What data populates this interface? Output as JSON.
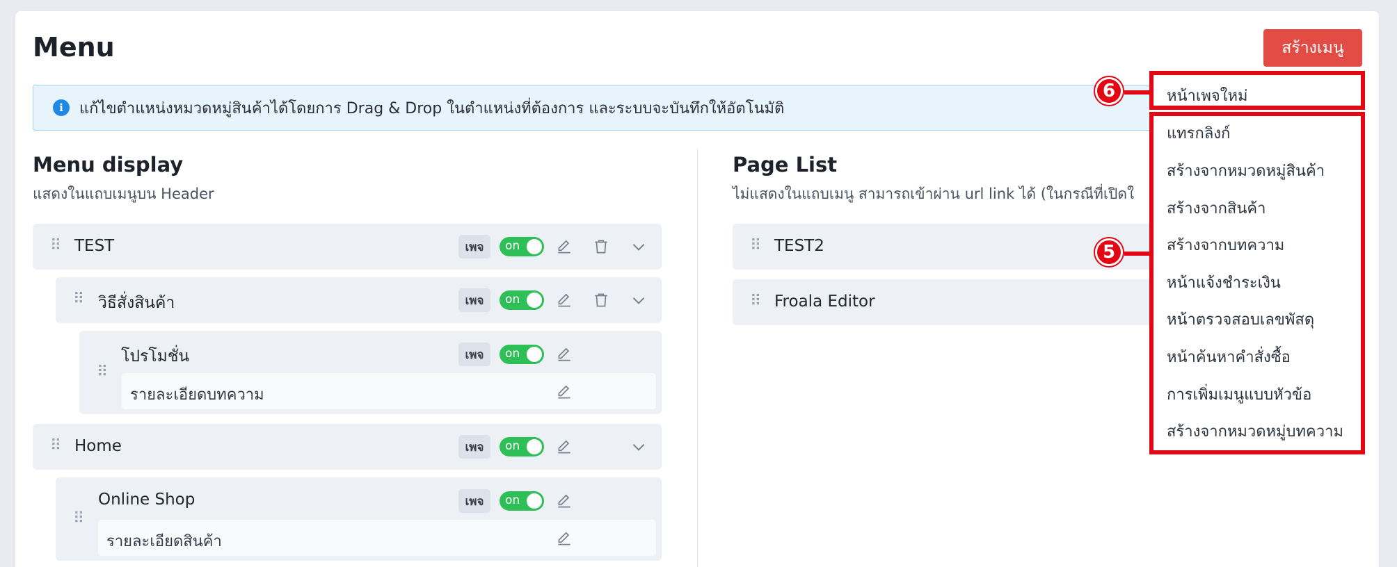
{
  "page": {
    "title": "Menu",
    "create_button": "สร้างเมนู"
  },
  "alert": {
    "icon": "info-icon",
    "icon_glyph": "i",
    "text": "แก้ไขตำแหน่งหมวดหมู่สินค้าได้โดยการ Drag & Drop ในตำแหน่งที่ต้องการ และระบบจะบันทึกให้อัตโนมัติ"
  },
  "menu_display": {
    "title": "Menu display",
    "subtitle": "แสดงในแถบเมนูบน Header",
    "items": [
      {
        "label": "TEST",
        "badge": "เพจ",
        "toggle": "on"
      },
      {
        "label": "วิธีสั่งสินค้า",
        "badge": "เพจ",
        "toggle": "on"
      },
      {
        "label": "โปรโมชั่น",
        "badge": "เพจ",
        "toggle": "on",
        "child": "รายละเอียดบทความ"
      },
      {
        "label": "Home",
        "badge": "เพจ",
        "toggle": "on"
      },
      {
        "label": "Online Shop",
        "badge": "เพจ",
        "toggle": "on",
        "child": "รายละเอียดสินค้า"
      }
    ]
  },
  "page_list": {
    "title": "Page List",
    "subtitle": "ไม่แสดงในแถบเมนู สามารถเข้าผ่าน url link ได้ (ในกรณีที่เปิดใ",
    "items": [
      {
        "label": "TEST2"
      },
      {
        "label": "Froala Editor"
      }
    ]
  },
  "dropdown": {
    "items": [
      "หน้าเพจใหม่",
      "แทรกลิงก์",
      "สร้างจากหมวดหมู่สินค้า",
      "สร้างจากสินค้า",
      "สร้างจากบทความ",
      "หน้าแจ้งชำระเงิน",
      "หน้าตรวจสอบเลขพัสดุ",
      "หน้าค้นหาคำสั่งซื้อ",
      "การเพิ่มเมนูแบบหัวข้อ",
      "สร้างจากหมวดหมู่บทความ"
    ]
  },
  "annotations": {
    "marker_top": "6",
    "marker_bottom": "5"
  },
  "colors": {
    "primary_button": "#e24c45",
    "toggle_on": "#2fbf57",
    "annotation_red": "#e30613",
    "alert_bg": "#e7f4fc"
  }
}
